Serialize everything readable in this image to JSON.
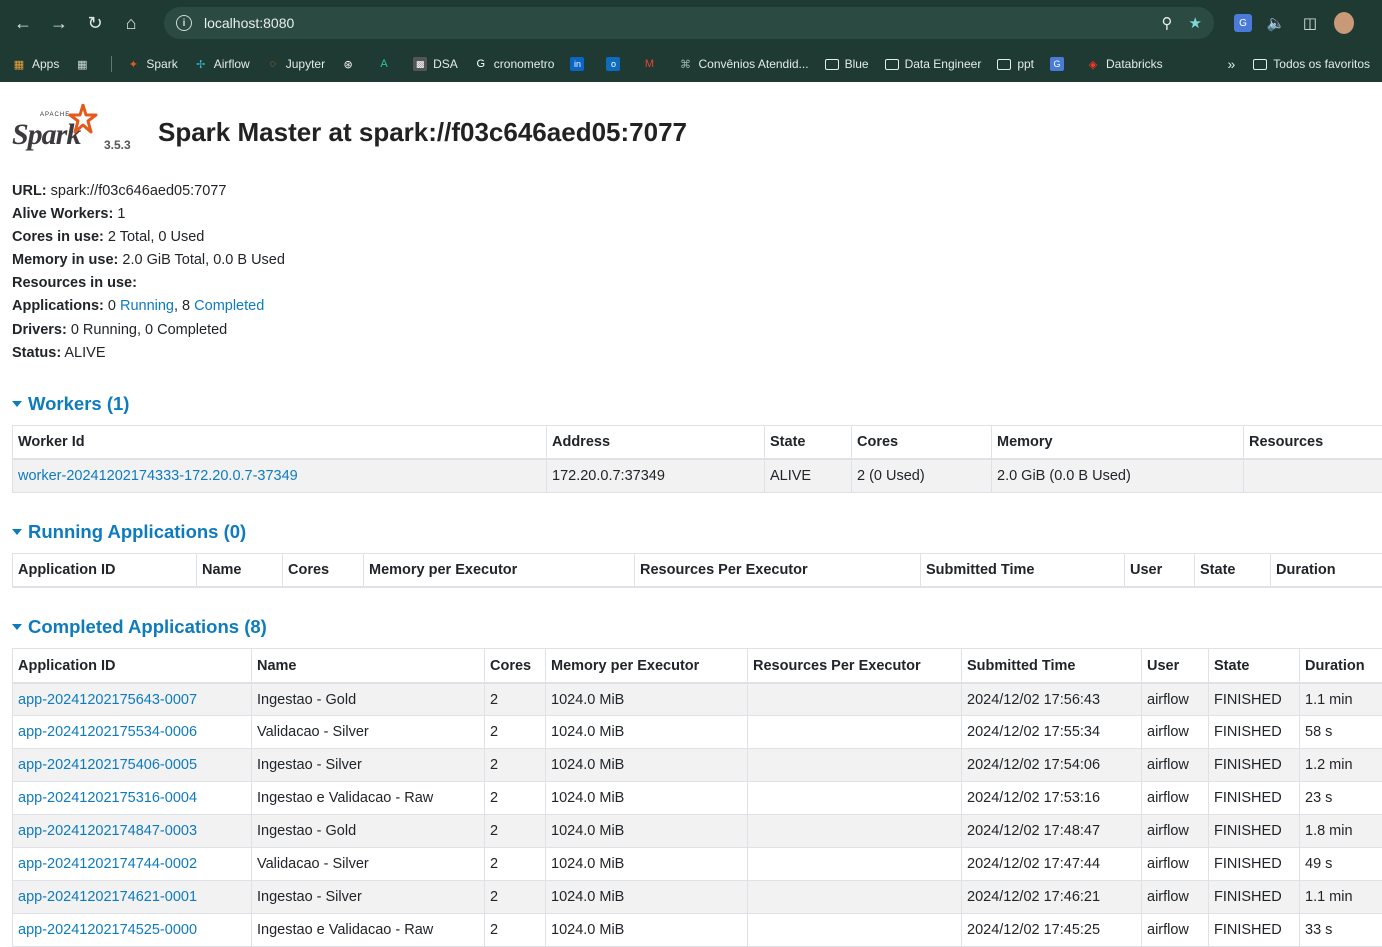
{
  "browser": {
    "url": "localhost:8080",
    "bookmarks": [
      {
        "label": "Apps",
        "icon": "apps-grid-icon"
      },
      {
        "label": "",
        "icon": "grid-icon"
      },
      {
        "label": "Spark",
        "icon": "spark-icon"
      },
      {
        "label": "Airflow",
        "icon": "airflow-icon"
      },
      {
        "label": "Jupyter",
        "icon": "jupyter-icon"
      },
      {
        "label": "",
        "icon": "openai-icon"
      },
      {
        "label": "",
        "icon": "a-logo-icon"
      },
      {
        "label": "DSA",
        "icon": "dsa-icon"
      },
      {
        "label": "cronometro",
        "icon": "google-icon"
      },
      {
        "label": "",
        "icon": "linkedin-icon"
      },
      {
        "label": "",
        "icon": "outlook-icon"
      },
      {
        "label": "",
        "icon": "gmail-icon"
      },
      {
        "label": "Convênios Atendid...",
        "icon": "convenios-icon"
      },
      {
        "label": "Blue",
        "icon": "folder-icon"
      },
      {
        "label": "Data Engineer",
        "icon": "folder-icon"
      },
      {
        "label": "ppt",
        "icon": "folder-icon"
      },
      {
        "label": "",
        "icon": "translate-icon"
      },
      {
        "label": "Databricks",
        "icon": "databricks-icon"
      }
    ],
    "more_label": "»",
    "all_bookmarks_label": "Todos os favoritos"
  },
  "header": {
    "logo_apache": "APACHE",
    "logo_word": "Spark",
    "version": "3.5.3",
    "title": "Spark Master at spark://f03c646aed05:7077"
  },
  "summary": {
    "url_label": "URL:",
    "url_value": "spark://f03c646aed05:7077",
    "alive_workers_label": "Alive Workers:",
    "alive_workers_value": "1",
    "cores_label": "Cores in use:",
    "cores_value": "2 Total, 0 Used",
    "memory_label": "Memory in use:",
    "memory_value": "2.0 GiB Total, 0.0 B Used",
    "resources_label": "Resources in use:",
    "applications_label": "Applications:",
    "applications_running_count": "0",
    "applications_running_link": "Running",
    "applications_sep": ", 8 ",
    "applications_completed_link": "Completed",
    "drivers_label": "Drivers:",
    "drivers_value": "0 Running, 0 Completed",
    "status_label": "Status:",
    "status_value": "ALIVE"
  },
  "workers": {
    "title": "Workers (1)",
    "columns": [
      "Worker Id",
      "Address",
      "State",
      "Cores",
      "Memory",
      "Resources"
    ],
    "rows": [
      [
        "worker-20241202174333-172.20.0.7-37349",
        "172.20.0.7:37349",
        "ALIVE",
        "2 (0 Used)",
        "2.0 GiB (0.0 B Used)",
        ""
      ]
    ]
  },
  "running": {
    "title": "Running Applications (0)",
    "columns": [
      "Application ID",
      "Name",
      "Cores",
      "Memory per Executor",
      "Resources Per Executor",
      "Submitted Time",
      "User",
      "State",
      "Duration"
    ]
  },
  "completed": {
    "title": "Completed Applications (8)",
    "columns": [
      "Application ID",
      "Name",
      "Cores",
      "Memory per Executor",
      "Resources Per Executor",
      "Submitted Time",
      "User",
      "State",
      "Duration"
    ],
    "rows": [
      [
        "app-20241202175643-0007",
        "Ingestao - Gold",
        "2",
        "1024.0 MiB",
        "",
        "2024/12/02 17:56:43",
        "airflow",
        "FINISHED",
        "1.1 min"
      ],
      [
        "app-20241202175534-0006",
        "Validacao - Silver",
        "2",
        "1024.0 MiB",
        "",
        "2024/12/02 17:55:34",
        "airflow",
        "FINISHED",
        "58 s"
      ],
      [
        "app-20241202175406-0005",
        "Ingestao - Silver",
        "2",
        "1024.0 MiB",
        "",
        "2024/12/02 17:54:06",
        "airflow",
        "FINISHED",
        "1.2 min"
      ],
      [
        "app-20241202175316-0004",
        "Ingestao e Validacao - Raw",
        "2",
        "1024.0 MiB",
        "",
        "2024/12/02 17:53:16",
        "airflow",
        "FINISHED",
        "23 s"
      ],
      [
        "app-20241202174847-0003",
        "Ingestao - Gold",
        "2",
        "1024.0 MiB",
        "",
        "2024/12/02 17:48:47",
        "airflow",
        "FINISHED",
        "1.8 min"
      ],
      [
        "app-20241202174744-0002",
        "Validacao - Silver",
        "2",
        "1024.0 MiB",
        "",
        "2024/12/02 17:47:44",
        "airflow",
        "FINISHED",
        "49 s"
      ],
      [
        "app-20241202174621-0001",
        "Ingestao - Silver",
        "2",
        "1024.0 MiB",
        "",
        "2024/12/02 17:46:21",
        "airflow",
        "FINISHED",
        "1.1 min"
      ],
      [
        "app-20241202174525-0000",
        "Ingestao e Validacao - Raw",
        "2",
        "1024.0 MiB",
        "",
        "2024/12/02 17:45:25",
        "airflow",
        "FINISHED",
        "33 s"
      ]
    ]
  },
  "colors": {
    "link": "#0e7bbd",
    "chrome_bg": "#1f3a33"
  }
}
